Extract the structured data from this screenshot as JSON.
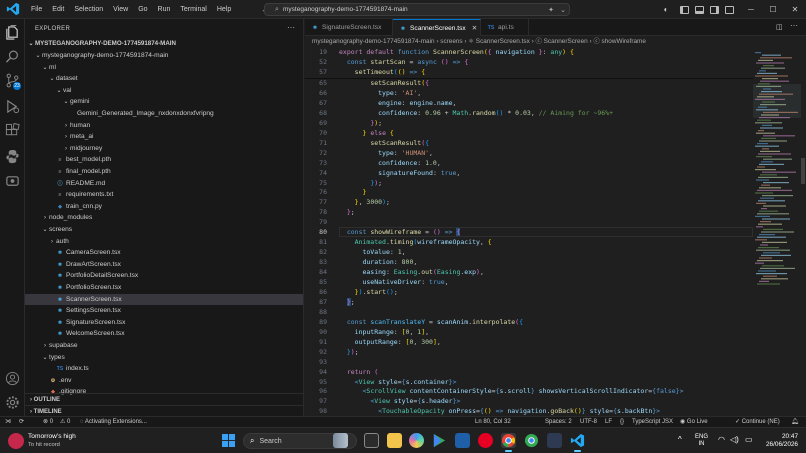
{
  "titlebar": {
    "menu": [
      "File",
      "Edit",
      "Selection",
      "View",
      "Go",
      "Run",
      "Terminal",
      "Help"
    ],
    "command_center": "mysteganography-demo-1774591874-main"
  },
  "sidebar": {
    "title": "EXPLORER",
    "workspace": "MYSTEGANOGRAPHY-DEMO-1774591874-MAIN",
    "rows": [
      {
        "label": "mysteganography-demo-1774591874-main",
        "indent": 1,
        "chev": "⌄",
        "kind": ""
      },
      {
        "label": "ml",
        "indent": 2,
        "chev": "⌄",
        "kind": ""
      },
      {
        "label": "dataset",
        "indent": 3,
        "chev": "⌄",
        "kind": ""
      },
      {
        "label": "val",
        "indent": 4,
        "chev": "⌄",
        "kind": ""
      },
      {
        "label": "gemini",
        "indent": 5,
        "chev": "⌄",
        "kind": ""
      },
      {
        "label": "Gemini_Generated_Image_nxdonxdonxfvripng",
        "indent": 6,
        "chev": "",
        "kind": ""
      },
      {
        "label": "human",
        "indent": 5,
        "chev": "›",
        "kind": ""
      },
      {
        "label": "meta_ai",
        "indent": 5,
        "chev": "›",
        "kind": ""
      },
      {
        "label": "midjourney",
        "indent": 5,
        "chev": "›",
        "kind": ""
      },
      {
        "label": "best_model.pth",
        "indent": 3,
        "chev": "",
        "kind": "pth",
        "icon": "≡"
      },
      {
        "label": "final_model.pth",
        "indent": 3,
        "chev": "",
        "kind": "pth",
        "icon": "≡"
      },
      {
        "label": "README.md",
        "indent": 3,
        "chev": "",
        "kind": "md",
        "icon": "ⓘ"
      },
      {
        "label": "requirements.txt",
        "indent": 3,
        "chev": "",
        "kind": "txt",
        "icon": "≡"
      },
      {
        "label": "train_cnn.py",
        "indent": 3,
        "chev": "",
        "kind": "py",
        "icon": "◆"
      },
      {
        "label": "node_modules",
        "indent": 2,
        "chev": "›",
        "kind": ""
      },
      {
        "label": "screens",
        "indent": 2,
        "chev": "⌄",
        "kind": ""
      },
      {
        "label": "auth",
        "indent": 3,
        "chev": "›",
        "kind": ""
      },
      {
        "label": "CameraScreen.tsx",
        "indent": 3,
        "chev": "",
        "kind": "tsx",
        "icon": "⚛"
      },
      {
        "label": "DrawArtScreen.tsx",
        "indent": 3,
        "chev": "",
        "kind": "tsx",
        "icon": "⚛"
      },
      {
        "label": "PortfolioDetailScreen.tsx",
        "indent": 3,
        "chev": "",
        "kind": "tsx",
        "icon": "⚛"
      },
      {
        "label": "PortfolioScreen.tsx",
        "indent": 3,
        "chev": "",
        "kind": "tsx",
        "icon": "⚛"
      },
      {
        "label": "ScannerScreen.tsx",
        "indent": 3,
        "chev": "",
        "kind": "tsx",
        "icon": "⚛",
        "selected": true
      },
      {
        "label": "SettingsScreen.tsx",
        "indent": 3,
        "chev": "",
        "kind": "tsx",
        "icon": "⚛"
      },
      {
        "label": "SignatureScreen.tsx",
        "indent": 3,
        "chev": "",
        "kind": "tsx",
        "icon": "⚛"
      },
      {
        "label": "WelcomeScreen.tsx",
        "indent": 3,
        "chev": "",
        "kind": "tsx",
        "icon": "⚛"
      },
      {
        "label": "supabase",
        "indent": 2,
        "chev": "›",
        "kind": ""
      },
      {
        "label": "types",
        "indent": 2,
        "chev": "⌄",
        "kind": ""
      },
      {
        "label": "index.ts",
        "indent": 3,
        "chev": "",
        "kind": "ts",
        "icon": "TS"
      },
      {
        "label": ".env",
        "indent": 2,
        "chev": "",
        "kind": "env",
        "icon": "⚙"
      },
      {
        "label": ".gitignore",
        "indent": 2,
        "chev": "",
        "kind": "git",
        "icon": "◆"
      }
    ],
    "outline": "OUTLINE",
    "timeline": "TIMELINE"
  },
  "tabs": [
    {
      "label": "SignatureScreen.tsx",
      "kind": "tsx",
      "icon": "⚛"
    },
    {
      "label": "ScannerScreen.tsx",
      "kind": "tsx",
      "icon": "⚛",
      "active": true
    },
    {
      "label": "api.ts",
      "kind": "ts",
      "icon": "TS"
    }
  ],
  "breadcrumb": "mysteganography-demo-1774591874-main  ›  screens  ›  ⚛ ScannerScreen.tsx  ›  ⓒ ScannerScreen  ›  ⓒ showWireframe",
  "editor": {
    "sticky": [
      {
        "num": "19",
        "html": "<span class='k'>export default</span> <span class='kb'>function</span> <span class='f'>ScannerScreen</span><span class='p'>(</span><span class='p2'>{</span> <span class='v'>navigation</span> <span class='p2'>}</span>: <span class='ty'>any</span><span class='p'>)</span> <span class='p'>{</span>"
      },
      {
        "num": "52",
        "html": "  <span class='kb'>const</span> <span class='f'>startScan</span> = <span class='kb'>async</span> <span class='p2'>()</span> <span class='kb'>=></span> <span class='p2'>{</span>"
      },
      {
        "num": "57",
        "html": "    <span class='f'>setTimeout</span><span class='p3'>(</span><span class='p'>()</span> <span class='kb'>=></span> <span class='p'>{</span>"
      }
    ],
    "lines": [
      {
        "num": "65",
        "html": "        <span class='f'>setScanResult</span><span class='p'>(</span><span class='p2'>{</span>"
      },
      {
        "num": "66",
        "html": "          <span class='v'>type</span>: <span class='s'>'AI'</span>,"
      },
      {
        "num": "67",
        "html": "          <span class='v'>engine</span>: <span class='v'>engine</span>.<span class='v'>name</span>,"
      },
      {
        "num": "68",
        "html": "          <span class='v'>confidence</span>: <span class='n'>0.96</span> + <span class='ty'>Math</span>.<span class='f'>random</span><span class='p3'>()</span> * <span class='n'>0.03</span>, <span class='cm'>// Aiming for ~96%+</span>"
      },
      {
        "num": "69",
        "html": "        <span class='p2'>}</span><span class='p'>)</span>;"
      },
      {
        "num": "70",
        "html": "      <span class='p'>}</span> <span class='k'>else</span> <span class='p'>{</span>"
      },
      {
        "num": "71",
        "html": "        <span class='f'>setScanResult</span><span class='p2'>(</span><span class='p3'>{</span>"
      },
      {
        "num": "72",
        "html": "          <span class='v'>type</span>: <span class='s'>'HUMAN'</span>,"
      },
      {
        "num": "73",
        "html": "          <span class='v'>confidence</span>: <span class='n'>1.0</span>,"
      },
      {
        "num": "74",
        "html": "          <span class='v'>signatureFound</span>: <span class='kb'>true</span>,"
      },
      {
        "num": "75",
        "html": "        <span class='p3'>}</span><span class='p2'>)</span>;"
      },
      {
        "num": "76",
        "html": "      <span class='p'>}</span>"
      },
      {
        "num": "77",
        "html": "    <span class='p'>}</span>, <span class='n'>3000</span><span class='p3'>)</span>;"
      },
      {
        "num": "78",
        "html": "  <span class='p2'>}</span>;"
      },
      {
        "num": "79",
        "html": ""
      },
      {
        "num": "80",
        "html": "  <span class='kb'>const</span> <span class='f'>showWireframe</span> = <span class='p2'>()</span> <span class='kb'>=></span> <span class='p2 sel-hl'>{</span>",
        "current": true
      },
      {
        "num": "81",
        "html": "    <span class='ty'>Animated</span>.<span class='f'>timing</span><span class='p3'>(</span><span class='v'>wireframeOpacity</span>, <span class='p'>{</span>"
      },
      {
        "num": "82",
        "html": "      <span class='v'>toValue</span>: <span class='n'>1</span>,"
      },
      {
        "num": "83",
        "html": "      <span class='v'>duration</span>: <span class='n'>800</span>,"
      },
      {
        "num": "84",
        "html": "      <span class='v'>easing</span>: <span class='ty'>Easing</span>.<span class='f'>out</span><span class='p2'>(</span><span class='ty'>Easing</span>.<span class='v'>exp</span><span class='p2'>)</span>,"
      },
      {
        "num": "85",
        "html": "      <span class='v'>useNativeDriver</span>: <span class='kb'>true</span>,"
      },
      {
        "num": "86",
        "html": "    <span class='p'>}</span><span class='p3'>)</span>.<span class='f'>start</span><span class='p3'>()</span>;"
      },
      {
        "num": "87",
        "html": "  <span class='p2 sel-hl'>}</span>;"
      },
      {
        "num": "88",
        "html": ""
      },
      {
        "num": "89",
        "html": "  <span class='kb'>const</span> <span class='c'>scanTranslateY</span> = <span class='v'>scanAnim</span>.<span class='f'>interpolate</span><span class='p2'>(</span><span class='p3'>{</span>"
      },
      {
        "num": "90",
        "html": "    <span class='v'>inputRange</span>: <span class='p'>[</span><span class='n'>0</span>, <span class='n'>1</span><span class='p'>]</span>,"
      },
      {
        "num": "91",
        "html": "    <span class='v'>outputRange</span>: <span class='p'>[</span><span class='n'>0</span>, <span class='n'>300</span><span class='p'>]</span>,"
      },
      {
        "num": "92",
        "html": "  <span class='p3'>}</span><span class='p2'>)</span>;"
      },
      {
        "num": "93",
        "html": ""
      },
      {
        "num": "94",
        "html": "  <span class='k'>return</span> <span class='p2'>(</span>"
      },
      {
        "num": "95",
        "html": "    <span class='kb'>&lt;</span><span class='ty'>View</span> <span class='v'>style</span>=<span class='kb'>{</span><span class='v'>s</span>.<span class='v'>container</span><span class='kb'>}</span><span class='kb'>&gt;</span>"
      },
      {
        "num": "96",
        "html": "      <span class='kb'>&lt;</span><span class='ty'>ScrollView</span> <span class='v'>contentContainerStyle</span>=<span class='kb'>{</span><span class='v'>s</span>.<span class='v'>scroll</span><span class='kb'>}</span> <span class='v'>showsVerticalScrollIndicator</span>=<span class='kb'>{false}</span><span class='kb'>&gt;</span>"
      },
      {
        "num": "97",
        "html": "        <span class='kb'>&lt;</span><span class='ty'>View</span> <span class='v'>style</span>=<span class='kb'>{</span><span class='v'>s</span>.<span class='v'>header</span><span class='kb'>}</span><span class='kb'>&gt;</span>"
      },
      {
        "num": "98",
        "html": "          <span class='kb'>&lt;</span><span class='ty'>TouchableOpacity</span> <span class='v'>onPress</span>=<span class='kb'>{</span><span class='p'>()</span> <span class='kb'>=></span> <span class='v'>navigation</span>.<span class='f'>goBack</span><span class='p'>()</span><span class='kb'>}</span> <span class='v'>style</span>=<span class='kb'>{</span><span class='v'>s</span>.<span class='v'>backBtn</span><span class='kb'>}</span><span class='kb'>&gt;</span>"
      }
    ]
  },
  "statusbar": {
    "errors": "⊗ 0",
    "warnings": "⚠ 0",
    "activity": "Activating Extensions...",
    "position": "Ln 80, Col 32",
    "spaces": "Spaces: 2",
    "encoding": "UTF-8",
    "eol": "LF",
    "language": "TypeScript JSX",
    "golive": "Go Live",
    "continue": "Continue (NE)"
  },
  "taskbar": {
    "weather_title": "Tomorrow's high",
    "weather_sub": "To hit record",
    "search_placeholder": "Search",
    "lang_top": "ENG",
    "lang_bottom": "IN",
    "time": "20:47",
    "date": "26/06/2026"
  },
  "colors": {
    "accent": "#0078d4",
    "selection": "#37373d"
  }
}
